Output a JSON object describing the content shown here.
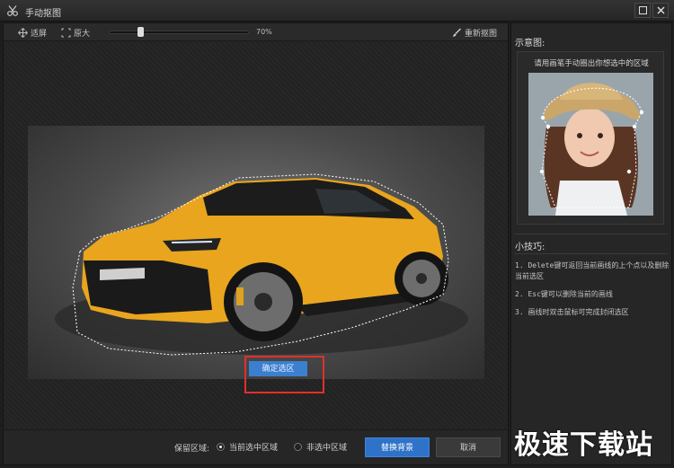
{
  "window": {
    "title": "手动抠图",
    "icons": {
      "app": "scissors-icon",
      "maximize": "maximize-icon",
      "close": "close-icon"
    }
  },
  "toolbar": {
    "fit_label": "适屏",
    "original_label": "原大",
    "zoom_value": 0.7,
    "zoom_text": "70%",
    "redraw_label": "重新抠图"
  },
  "canvas": {
    "confirm_button_label": "确定选区",
    "highlight_color": "#e0302a"
  },
  "bottom": {
    "keep_area_label": "保留区域:",
    "options": [
      {
        "label": "当前选中区域",
        "selected": true
      },
      {
        "label": "非选中区域",
        "selected": false
      }
    ],
    "replace_button_label": "替换背景",
    "cancel_button_label": "取消"
  },
  "sidebar": {
    "example_title": "示意图:",
    "example_caption": "请用画笔手动圈出你想选中的区域",
    "tips_title": "小技巧:",
    "tips": [
      "1. Delete键可返回当前画线的上个点以及删除当前选区",
      "2. Esc键可以删除当前的画线",
      "3. 画线时双击鼠标可完成封闭选区"
    ]
  },
  "watermark": "极速下载站",
  "colors": {
    "accent": "#2f73c9",
    "background": "#1e1e1e"
  }
}
